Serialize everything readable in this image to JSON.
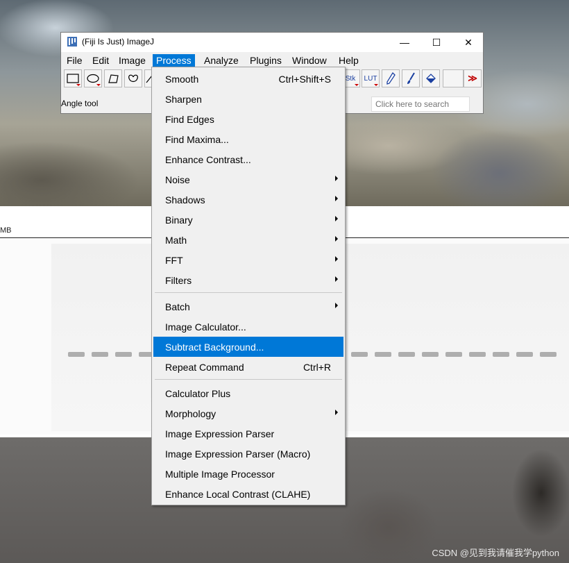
{
  "window": {
    "title": "(Fiji Is Just) ImageJ",
    "controls": {
      "minimize": "—",
      "maximize": "☐",
      "close": "✕"
    }
  },
  "menubar": [
    "File",
    "Edit",
    "Image",
    "Process",
    "Analyze",
    "Plugins",
    "Window",
    "Help"
  ],
  "active_menu": "Process",
  "toolbar": {
    "lut_label": "LUT",
    "stk_label": "Stk",
    "more_label": "≫",
    "icons": [
      "rectangle-tool-icon",
      "oval-tool-icon",
      "polygon-tool-icon",
      "freehand-tool-icon",
      "line-tool-icon",
      "stacks-tool-icon",
      "lut-tool-icon",
      "pencil-tool-icon",
      "brush-tool-icon",
      "flood-fill-tool-icon",
      "more-tools-icon"
    ]
  },
  "status": "Angle tool",
  "search": {
    "placeholder": "Click here to search"
  },
  "image_window": {
    "size_label": "MB"
  },
  "dropdown": {
    "items": [
      {
        "label": "Smooth",
        "shortcut": "Ctrl+Shift+S",
        "submenu": false
      },
      {
        "label": "Sharpen",
        "shortcut": "",
        "submenu": false
      },
      {
        "label": "Find Edges",
        "shortcut": "",
        "submenu": false
      },
      {
        "label": "Find Maxima...",
        "shortcut": "",
        "submenu": false
      },
      {
        "label": "Enhance Contrast...",
        "shortcut": "",
        "submenu": false
      },
      {
        "label": "Noise",
        "shortcut": "",
        "submenu": true
      },
      {
        "label": "Shadows",
        "shortcut": "",
        "submenu": true
      },
      {
        "label": "Binary",
        "shortcut": "",
        "submenu": true
      },
      {
        "label": "Math",
        "shortcut": "",
        "submenu": true
      },
      {
        "label": "FFT",
        "shortcut": "",
        "submenu": true
      },
      {
        "label": "Filters",
        "shortcut": "",
        "submenu": true
      },
      {
        "label": "Batch",
        "shortcut": "",
        "submenu": true
      },
      {
        "label": "Image Calculator...",
        "shortcut": "",
        "submenu": false
      },
      {
        "label": "Subtract Background...",
        "shortcut": "",
        "submenu": false,
        "highlighted": true
      },
      {
        "label": "Repeat Command",
        "shortcut": "Ctrl+R",
        "submenu": false
      },
      {
        "label": "Calculator Plus",
        "shortcut": "",
        "submenu": false
      },
      {
        "label": "Morphology",
        "shortcut": "",
        "submenu": true
      },
      {
        "label": "Image Expression Parser",
        "shortcut": "",
        "submenu": false
      },
      {
        "label": "Image Expression Parser (Macro)",
        "shortcut": "",
        "submenu": false
      },
      {
        "label": "Multiple Image Processor",
        "shortcut": "",
        "submenu": false
      },
      {
        "label": "Enhance Local Contrast (CLAHE)",
        "shortcut": "",
        "submenu": false
      }
    ]
  },
  "watermark": "CSDN @见到我请催我学python",
  "colors": {
    "accent": "#0078d7",
    "menu_bg": "#f0f0f0",
    "tool_marker": "#cc0000"
  }
}
